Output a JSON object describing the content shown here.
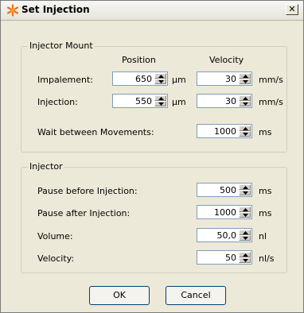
{
  "window": {
    "title": "Set Injection"
  },
  "injector_mount": {
    "title": "Injector Mount",
    "col_position": "Position",
    "col_velocity": "Velocity",
    "impalement": {
      "label": "Impalement:",
      "position": "650",
      "position_unit": "µm",
      "velocity": "30",
      "velocity_unit": "mm/s"
    },
    "injection": {
      "label": "Injection:",
      "position": "550",
      "position_unit": "µm",
      "velocity": "30",
      "velocity_unit": "mm/s"
    },
    "wait": {
      "label": "Wait between Movements:",
      "value": "1000",
      "unit": "ms"
    }
  },
  "injector": {
    "title": "Injector",
    "pause_before": {
      "label": "Pause before Injection:",
      "value": "500",
      "unit": "ms"
    },
    "pause_after": {
      "label": "Pause after Injection:",
      "value": "1000",
      "unit": "ms"
    },
    "volume": {
      "label": "Volume:",
      "value": "50,0",
      "unit": "nl"
    },
    "velocity": {
      "label": "Velocity:",
      "value": "50",
      "unit": "nl/s"
    }
  },
  "buttons": {
    "ok": "OK",
    "cancel": "Cancel"
  }
}
